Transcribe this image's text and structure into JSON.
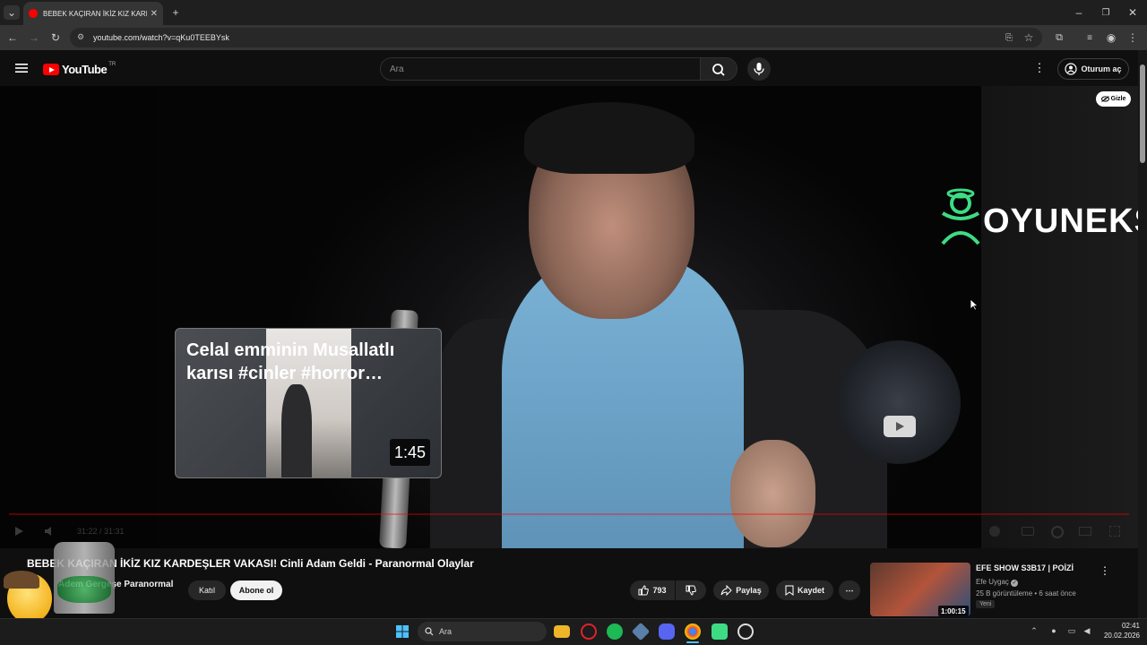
{
  "browser": {
    "tab_title": "BEBEK KAÇIRAN İKİZ KIZ KARDEŞ",
    "url": "youtube.com/watch?v=qKu0TEEBYsk"
  },
  "masthead": {
    "logo_text": "YouTube",
    "country_code": "TR",
    "search_placeholder": "Ara",
    "signin_label": "Oturum aç"
  },
  "video": {
    "hide_label": "Gizle",
    "watermark": "OYUNEKS",
    "timecode": "31:22 / 31:31",
    "card": {
      "title": "Celal emminin Musallatlı karısı #cinler #horror…",
      "duration": "1:45"
    }
  },
  "info": {
    "title": "BEBEK KAÇIRAN İKİZ KIZ KARDEŞLER VAKASI! Cinli Adam Geldi - Paranormal Olaylar",
    "channel": "Adem Gergeşe Paranormal",
    "join_label": "Katıl",
    "subscribe_label": "Abone ol",
    "likes": "793",
    "share_label": "Paylaş",
    "save_label": "Kaydet"
  },
  "recommendation": {
    "title": "EFE SHOW S3B17 | POİZİ",
    "channel": "Efe Uygaç",
    "meta": "25 B görüntüleme • 6 saat önce",
    "badge": "Yeni",
    "duration": "1:00:15"
  },
  "taskbar": {
    "search_label": "Ara",
    "time": "02:41",
    "date": "20.02.2026"
  },
  "colors": {
    "youtube_red": "#ff0000",
    "link_blue": "#3ea6ff",
    "oyuneks_green": "#3ddc84"
  }
}
